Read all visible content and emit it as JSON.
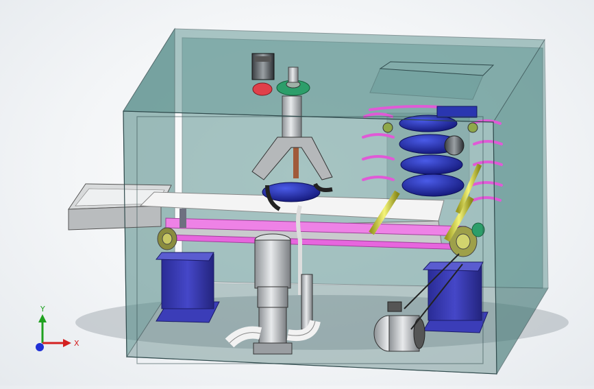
{
  "viewport": {
    "background": "#f3f5f7",
    "colors": {
      "enclosure_glass": "#4e8a87",
      "enclosure_edge": "#2f4a4c",
      "conveyor_belt": "#ee82e6",
      "support_stand": "#2e2fa6",
      "gear_green": "#2c9e6a",
      "gear_red": "#e0404a",
      "gripper_bowl": "#1a1a8a",
      "spiral_flights": "#e05ad6",
      "guide_rods": "#d6d63a",
      "motor_gray": "#bfc3c6",
      "pipe_white": "#f2f2f2"
    }
  },
  "triad": {
    "x_label": "X",
    "y_label": "Y",
    "z_label": "",
    "x_color": "#d42020",
    "y_color": "#1fa11f",
    "z_color": "#2030d6"
  },
  "components": [
    "enclosure-icon",
    "feed-chute-icon",
    "belt-conveyor-icon",
    "stepper-motor-icon",
    "gear-pair-icon",
    "gripper-icon",
    "spiral-stacker-icon",
    "vertical-pump-icon",
    "drive-motor-icon",
    "support-stand-icon"
  ]
}
